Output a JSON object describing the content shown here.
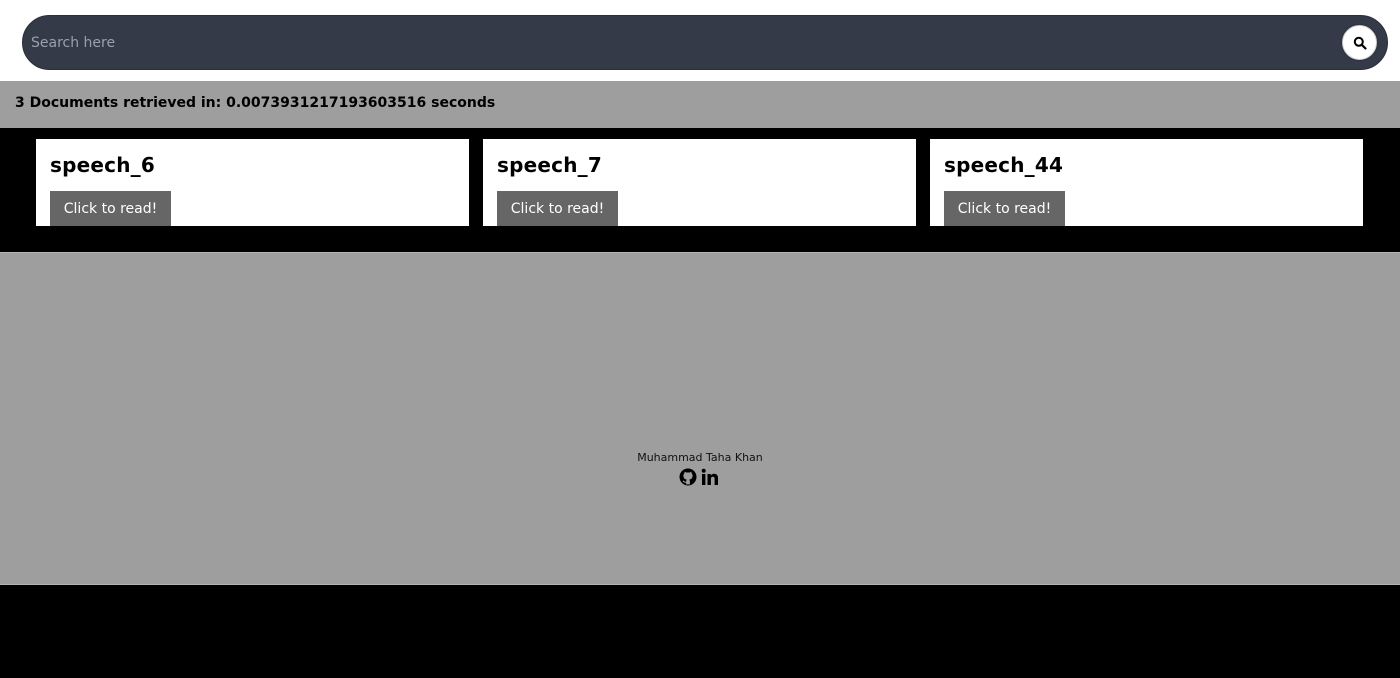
{
  "search": {
    "placeholder": "Search here",
    "button_icon": "search-icon"
  },
  "status": {
    "text": "3 Documents retrieved in: 0.0073931217193603516 seconds"
  },
  "results": [
    {
      "title": "speech_6",
      "button_label": "Click to read!"
    },
    {
      "title": "speech_7",
      "button_label": "Click to read!"
    },
    {
      "title": "speech_44",
      "button_label": "Click to read!"
    }
  ],
  "footer": {
    "author": "Muhammad Taha Khan",
    "icons": [
      "github-icon",
      "linkedin-icon"
    ]
  },
  "colors": {
    "search_bar": "#343a48",
    "status_bg": "#9e9e9e",
    "button_bg": "#666666",
    "page_bg": "#000000"
  }
}
